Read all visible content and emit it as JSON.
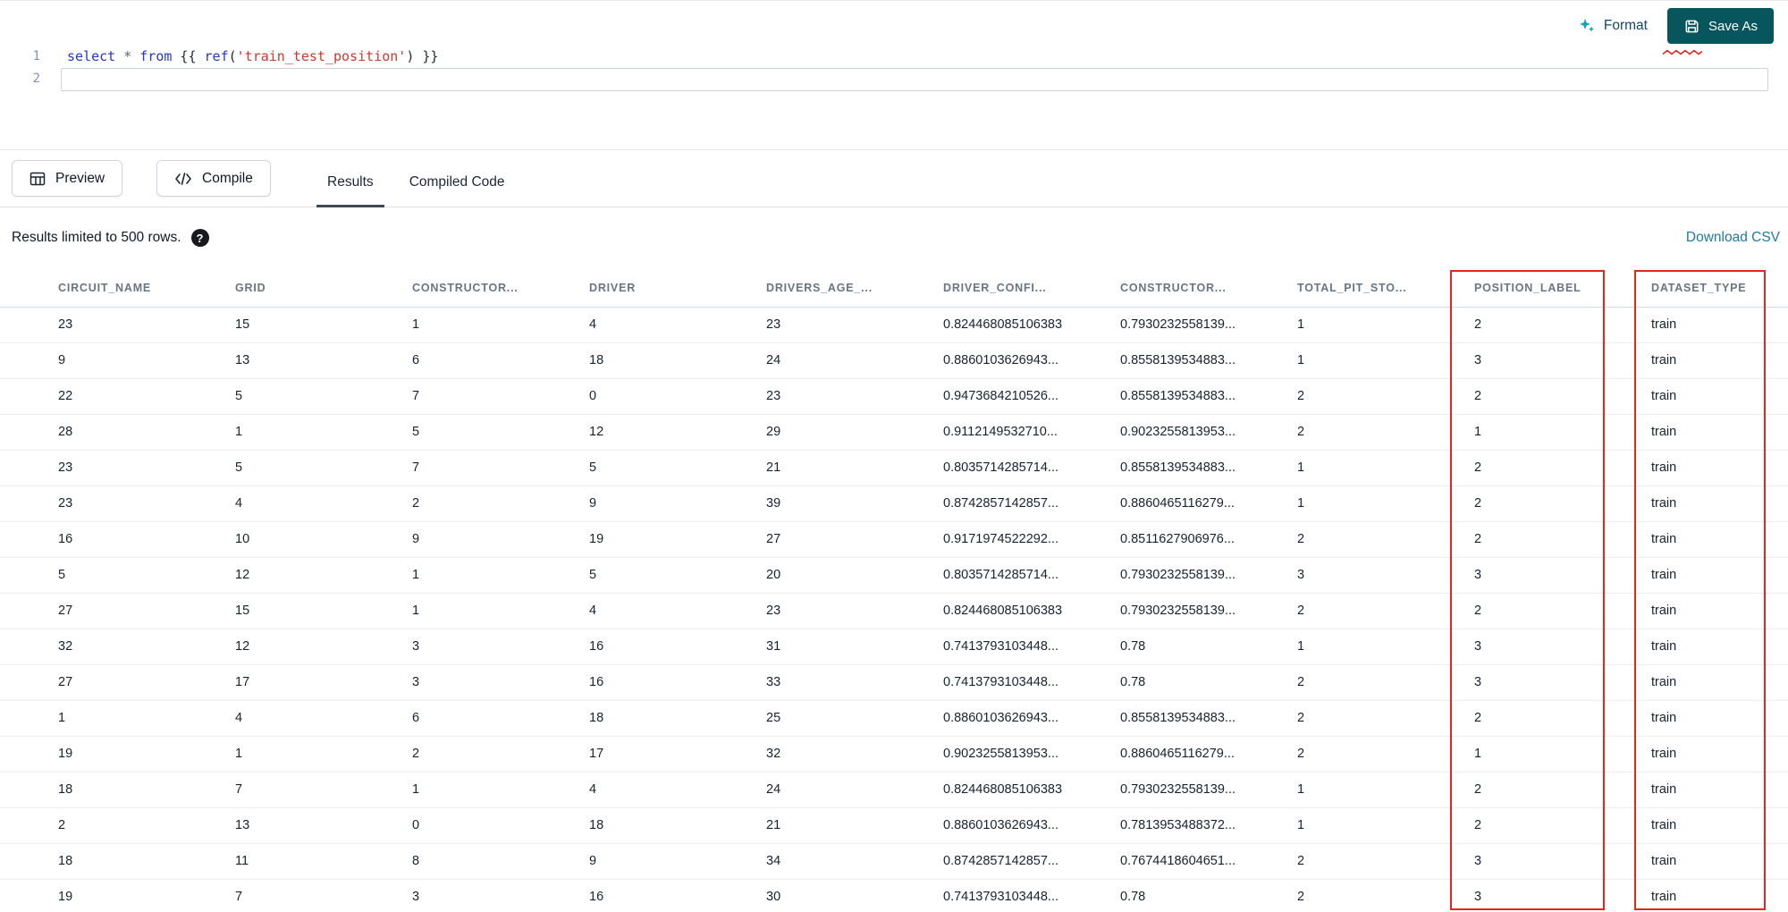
{
  "editor": {
    "format_button": "Format",
    "save_as_button": "Save As",
    "lines": [
      {
        "number": "1",
        "tokens": [
          {
            "t": "keyword",
            "v": "select"
          },
          {
            "t": "plain",
            "v": " "
          },
          {
            "t": "operator",
            "v": "*"
          },
          {
            "t": "plain",
            "v": " "
          },
          {
            "t": "keyword",
            "v": "from"
          },
          {
            "t": "plain",
            "v": " {{ "
          },
          {
            "t": "keyword",
            "v": "ref"
          },
          {
            "t": "plain",
            "v": "("
          },
          {
            "t": "string",
            "v": "'train_test_position'"
          },
          {
            "t": "plain",
            "v": ") }}"
          }
        ]
      },
      {
        "number": "2",
        "tokens": []
      }
    ]
  },
  "toolbar": {
    "preview": "Preview",
    "compile": "Compile",
    "tabs": [
      {
        "label": "Results",
        "active": true
      },
      {
        "label": "Compiled Code",
        "active": false
      }
    ]
  },
  "results": {
    "limit_note": "Results limited to 500 rows.",
    "help_glyph": "?",
    "download_csv": "Download CSV",
    "table": {
      "columns": [
        "CIRCUIT_NAME",
        "GRID",
        "CONSTRUCTOR...",
        "DRIVER",
        "DRIVERS_AGE_...",
        "DRIVER_CONFI...",
        "CONSTRUCTOR...",
        "TOTAL_PIT_STO...",
        "POSITION_LABEL",
        "DATASET_TYPE"
      ],
      "highlighted_columns": [
        "POSITION_LABEL",
        "DATASET_TYPE"
      ],
      "rows": [
        [
          "23",
          "15",
          "1",
          "4",
          "23",
          "0.824468085106383",
          "0.7930232558139...",
          "1",
          "2",
          "train"
        ],
        [
          "9",
          "13",
          "6",
          "18",
          "24",
          "0.8860103626943...",
          "0.8558139534883...",
          "1",
          "3",
          "train"
        ],
        [
          "22",
          "5",
          "7",
          "0",
          "23",
          "0.9473684210526...",
          "0.8558139534883...",
          "2",
          "2",
          "train"
        ],
        [
          "28",
          "1",
          "5",
          "12",
          "29",
          "0.9112149532710...",
          "0.9023255813953...",
          "2",
          "1",
          "train"
        ],
        [
          "23",
          "5",
          "7",
          "5",
          "21",
          "0.8035714285714...",
          "0.8558139534883...",
          "1",
          "2",
          "train"
        ],
        [
          "23",
          "4",
          "2",
          "9",
          "39",
          "0.8742857142857...",
          "0.8860465116279...",
          "1",
          "2",
          "train"
        ],
        [
          "16",
          "10",
          "9",
          "19",
          "27",
          "0.9171974522292...",
          "0.8511627906976...",
          "2",
          "2",
          "train"
        ],
        [
          "5",
          "12",
          "1",
          "5",
          "20",
          "0.8035714285714...",
          "0.7930232558139...",
          "3",
          "3",
          "train"
        ],
        [
          "27",
          "15",
          "1",
          "4",
          "23",
          "0.824468085106383",
          "0.7930232558139...",
          "2",
          "2",
          "train"
        ],
        [
          "32",
          "12",
          "3",
          "16",
          "31",
          "0.7413793103448...",
          "0.78",
          "1",
          "3",
          "train"
        ],
        [
          "27",
          "17",
          "3",
          "16",
          "33",
          "0.7413793103448...",
          "0.78",
          "2",
          "3",
          "train"
        ],
        [
          "1",
          "4",
          "6",
          "18",
          "25",
          "0.8860103626943...",
          "0.8558139534883...",
          "2",
          "2",
          "train"
        ],
        [
          "19",
          "1",
          "2",
          "17",
          "32",
          "0.9023255813953...",
          "0.8860465116279...",
          "2",
          "1",
          "train"
        ],
        [
          "18",
          "7",
          "1",
          "4",
          "24",
          "0.824468085106383",
          "0.7930232558139...",
          "1",
          "2",
          "train"
        ],
        [
          "2",
          "13",
          "0",
          "18",
          "21",
          "0.8860103626943...",
          "0.7813953488372...",
          "1",
          "2",
          "train"
        ],
        [
          "18",
          "11",
          "8",
          "9",
          "34",
          "0.8742857142857...",
          "0.7674418604651...",
          "2",
          "3",
          "train"
        ],
        [
          "19",
          "7",
          "3",
          "16",
          "30",
          "0.7413793103448...",
          "0.78",
          "2",
          "3",
          "train"
        ]
      ]
    }
  },
  "icons": {
    "format": "sparkles-icon",
    "save_as": "save-icon",
    "preview": "table-grid-icon",
    "compile": "code-icon",
    "help": "question-icon"
  },
  "colors": {
    "accent_teal": "#07565e",
    "link_blue": "#1f7a9e",
    "annotation_red": "#e8241c",
    "keyword_blue": "#2038c7",
    "string_red": "#d0382e"
  }
}
